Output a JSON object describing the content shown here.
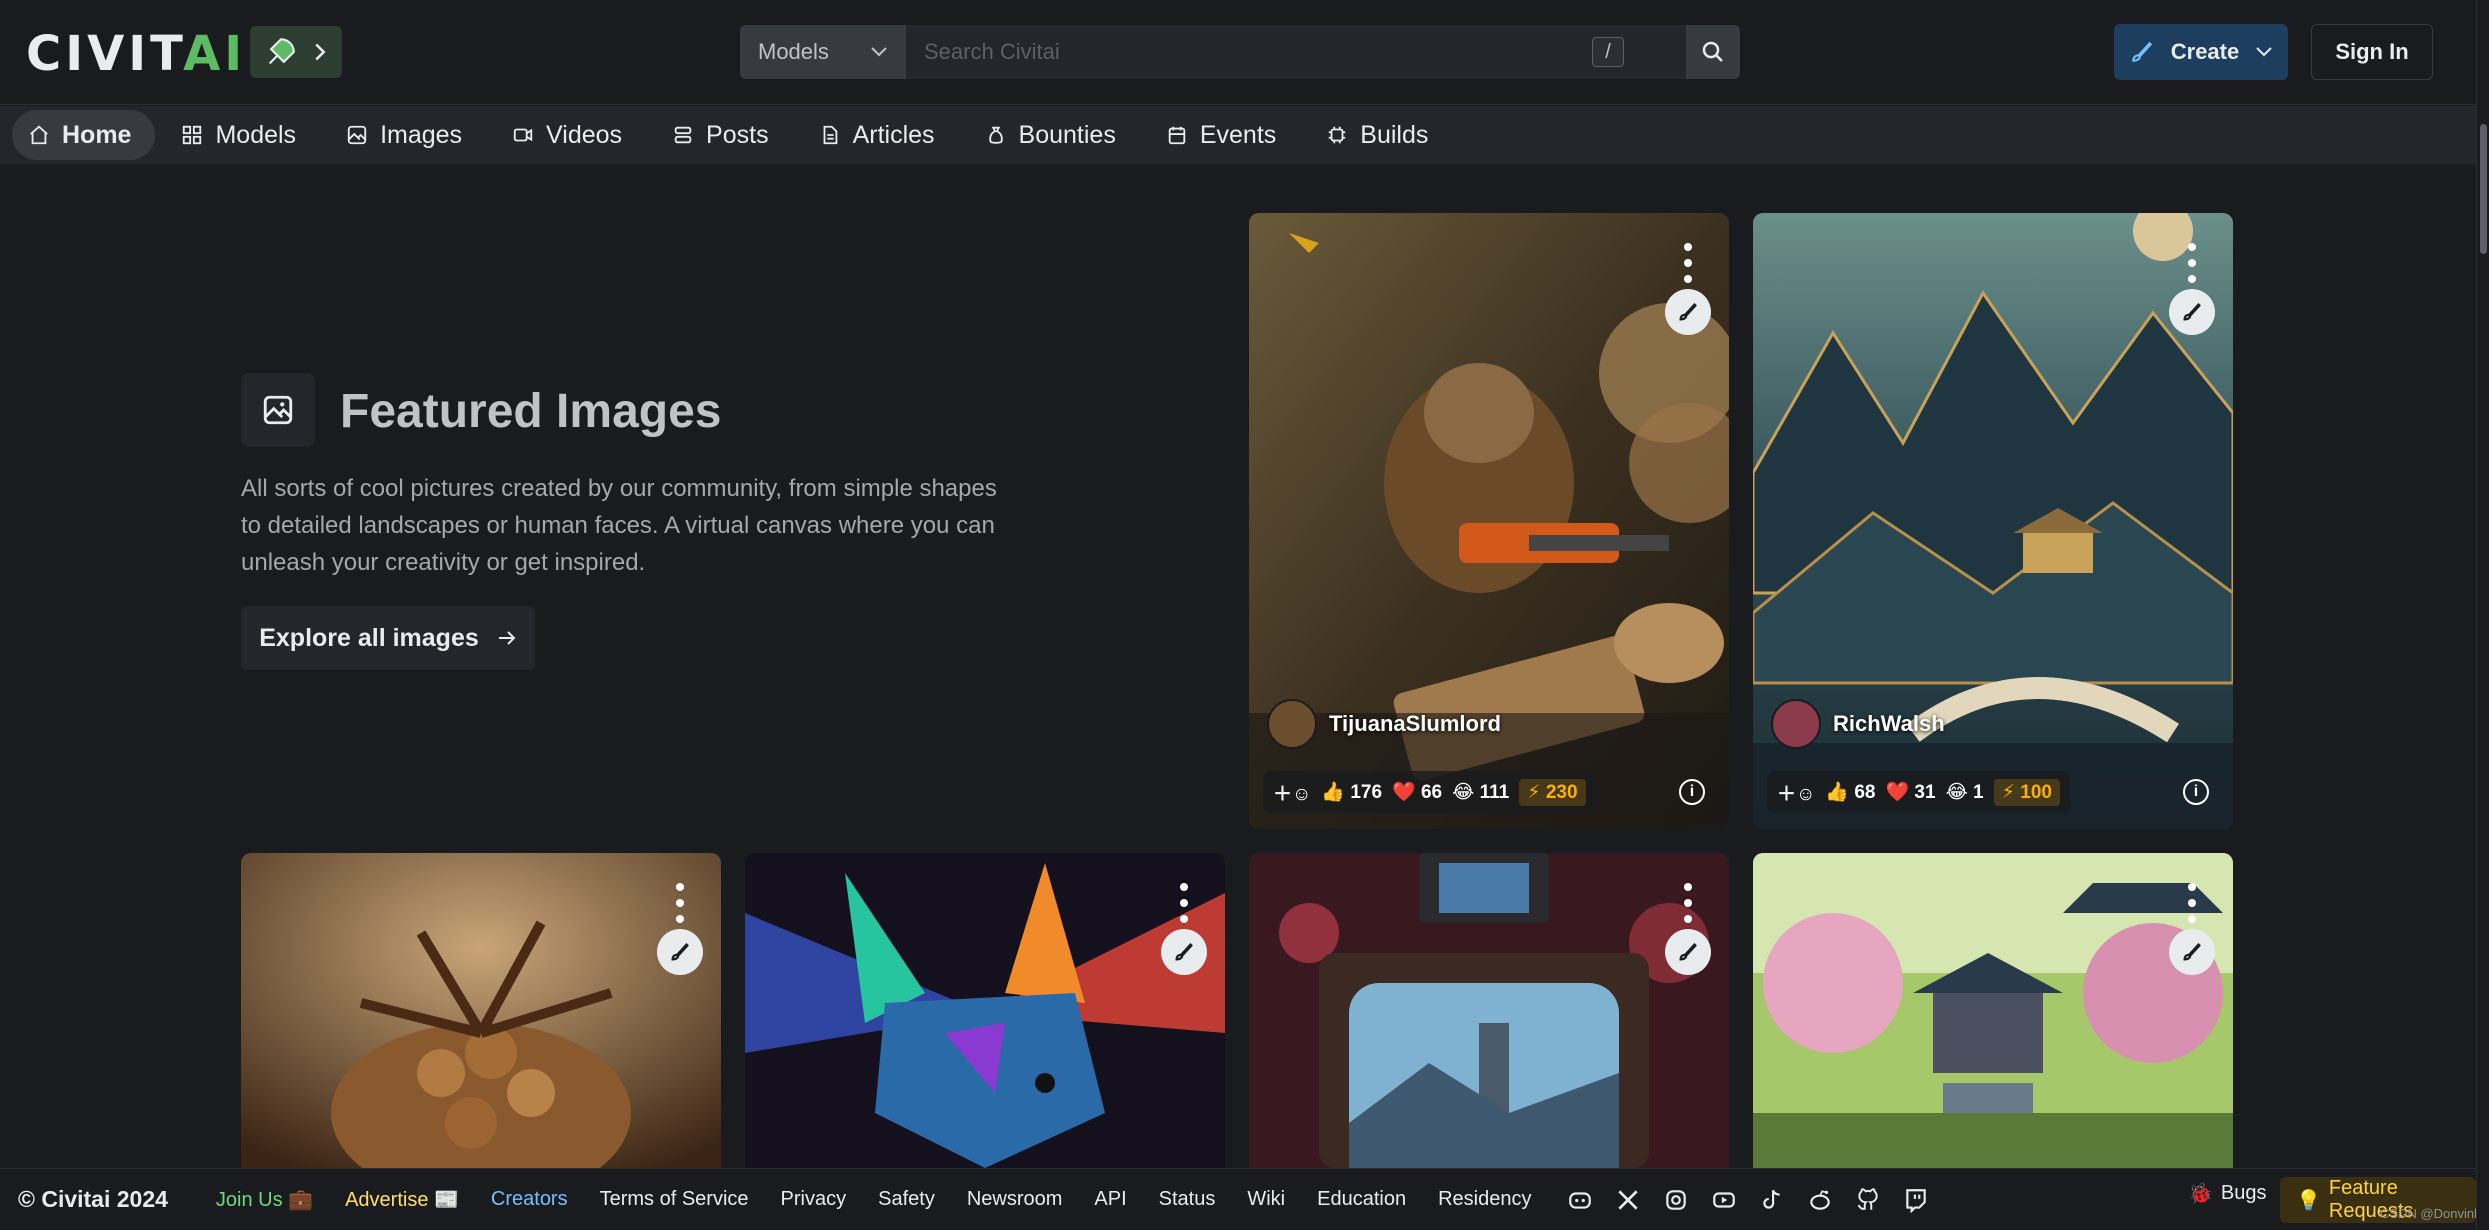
{
  "header": {
    "logo_part1": "CIVIT",
    "logo_part2": "AI",
    "search_category": "Models",
    "search_placeholder": "Search Civitai",
    "search_shortcut": "/",
    "create_label": "Create",
    "signin_label": "Sign In"
  },
  "nav": {
    "items": [
      {
        "label": "Home",
        "icon": "home-icon",
        "active": true
      },
      {
        "label": "Models",
        "icon": "grid-icon"
      },
      {
        "label": "Images",
        "icon": "photo-icon"
      },
      {
        "label": "Videos",
        "icon": "video-icon"
      },
      {
        "label": "Posts",
        "icon": "layout-list-icon"
      },
      {
        "label": "Articles",
        "icon": "file-text-icon"
      },
      {
        "label": "Bounties",
        "icon": "moneybag-icon"
      },
      {
        "label": "Events",
        "icon": "calendar-icon"
      },
      {
        "label": "Builds",
        "icon": "cpu-icon"
      }
    ]
  },
  "featured": {
    "title": "Featured Images",
    "description": "All sorts of cool pictures created by our community, from simple shapes to detailed landscapes or human faces. A virtual canvas where you can unleash your creativity or get inspired.",
    "explore_label": "Explore all images"
  },
  "cards": [
    {
      "username": "TijuanaSlumlord",
      "like": "176",
      "heart": "66",
      "laugh": "111",
      "buzz": "230",
      "theme": "beaver with chainsaw"
    },
    {
      "username": "RichWalsh",
      "like": "68",
      "heart": "31",
      "laugh": "1",
      "buzz": "100",
      "theme": "mountain landscape with bridge"
    },
    {
      "theme": "chocolate hazelnut splash"
    },
    {
      "theme": "polygonal neon dog"
    },
    {
      "theme": "retro tv"
    },
    {
      "theme": "cherry blossom pagoda"
    }
  ],
  "footer": {
    "copyright": "© Civitai 2024",
    "join": "Join Us 💼",
    "advertise": "Advertise 📰",
    "creators": "Creators",
    "terms": "Terms of Service",
    "privacy": "Privacy",
    "safety": "Safety",
    "newsroom": "Newsroom",
    "api": "API",
    "status": "Status",
    "wiki": "Wiki",
    "education": "Education",
    "residency": "Residency",
    "bugs": "Bugs",
    "feature_requests": "Feature Requests",
    "watermark": "CSDN @Donvink"
  },
  "colors": {
    "background": "#1a1b1e",
    "nav_bg": "#25262b",
    "accent_green": "#5dbb63",
    "create_blue": "#1d3e5e",
    "buzz_yellow": "#fab005"
  }
}
